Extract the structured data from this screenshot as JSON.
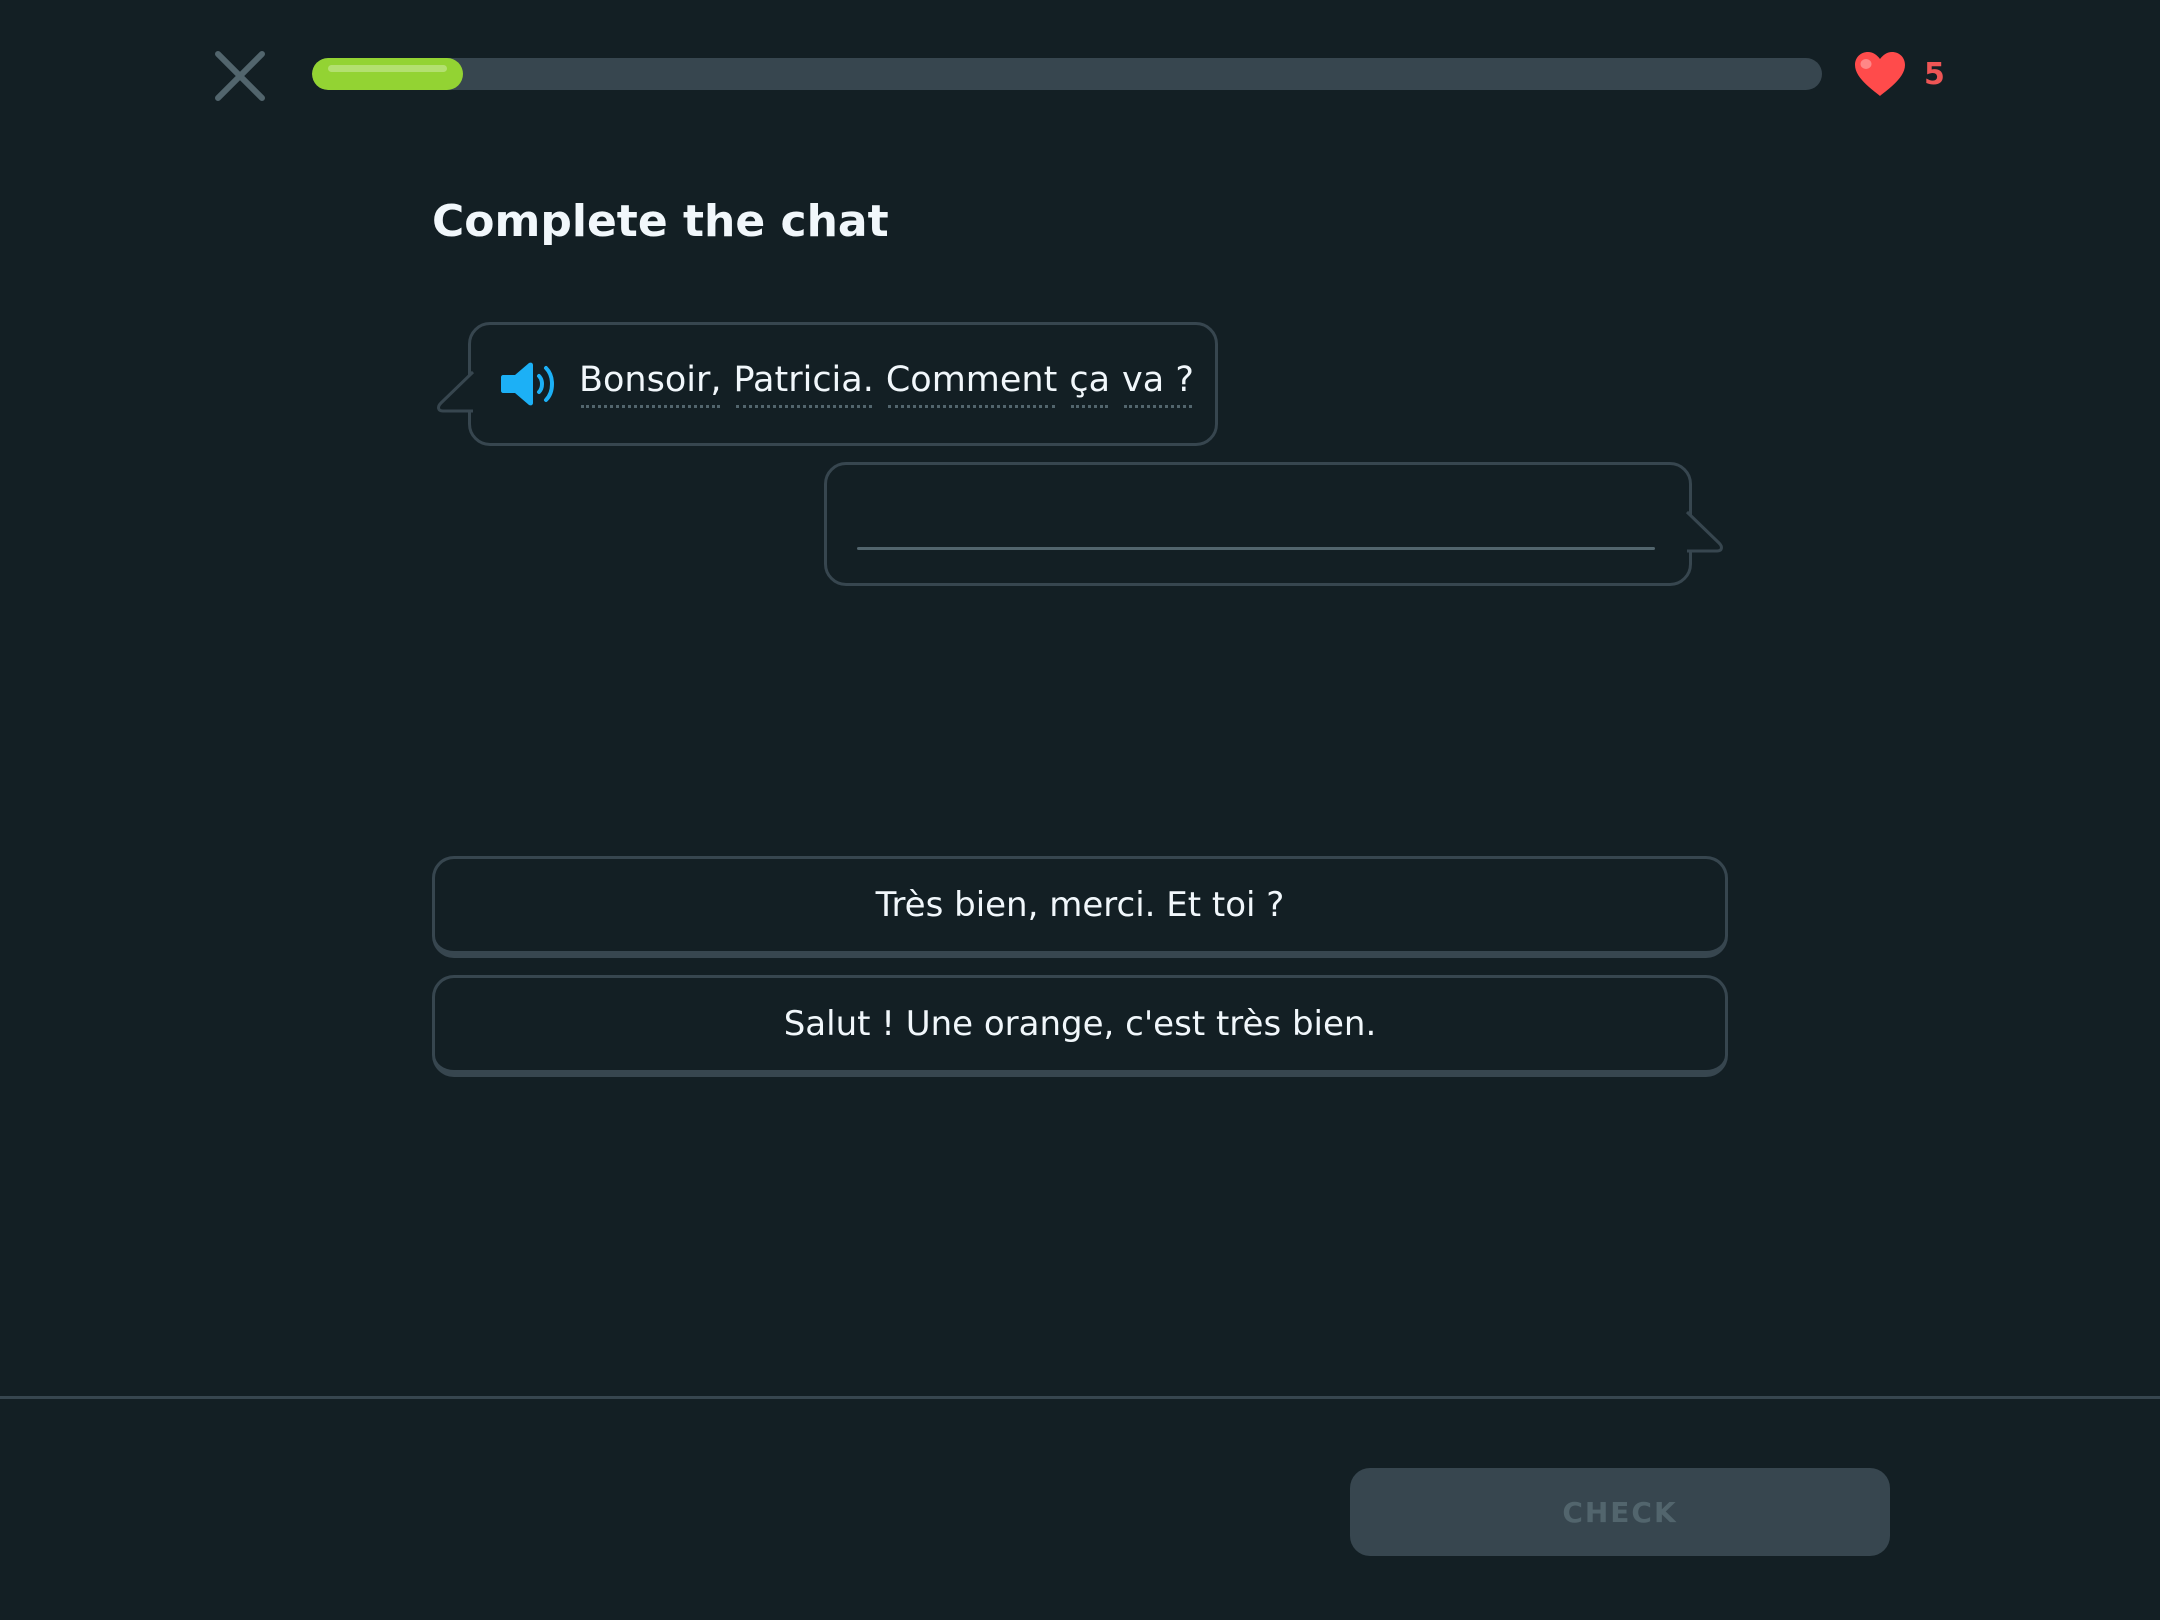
{
  "header": {
    "close_icon": "close-icon",
    "progress_fraction": 0.1,
    "hearts_icon": "heart-icon",
    "hearts_count": "5"
  },
  "exercise": {
    "title": "Complete the chat",
    "speaker_icon": "speaker-icon",
    "prompt_words": [
      "Bonsoir,",
      "Patricia.",
      "Comment",
      "ça",
      "va ?"
    ],
    "choices": [
      "Très bien, merci. Et toi ?",
      "Salut ! Une orange, c'est très bien."
    ]
  },
  "footer": {
    "check_label": "CHECK"
  },
  "colors": {
    "background": "#131f24",
    "border": "#37464f",
    "progress": "#93d333",
    "heart": "#ff4b4b",
    "speaker": "#1cb0f6",
    "text": "#f1f7fb"
  }
}
